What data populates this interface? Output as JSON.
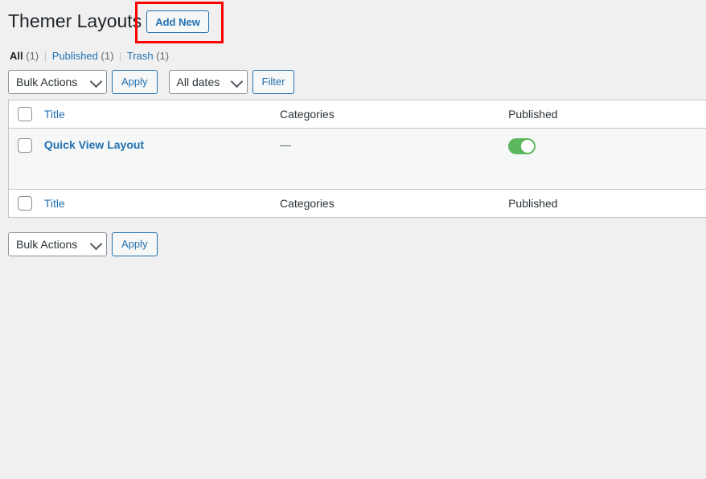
{
  "header": {
    "title": "Themer Layouts",
    "add_new_label": "Add New"
  },
  "status_links": {
    "items": [
      {
        "label": "All",
        "count": "(1)",
        "current": true
      },
      {
        "label": "Published",
        "count": "(1)",
        "current": false
      },
      {
        "label": "Trash",
        "count": "(1)",
        "current": false
      }
    ],
    "separator": "|"
  },
  "tablenav_top": {
    "bulk_actions_label": "Bulk Actions",
    "apply_label": "Apply",
    "dates_label": "All dates",
    "filter_label": "Filter"
  },
  "tablenav_bottom": {
    "bulk_actions_label": "Bulk Actions",
    "apply_label": "Apply"
  },
  "table": {
    "columns": {
      "title": "Title",
      "categories": "Categories",
      "published": "Published"
    },
    "rows": [
      {
        "title": "Quick View Layout",
        "categories": "—",
        "published": true
      }
    ]
  },
  "colors": {
    "link": "#2271b1",
    "toggle_on": "#5cb85c",
    "annotation": "#ff0000",
    "background": "#f0f0f1"
  }
}
